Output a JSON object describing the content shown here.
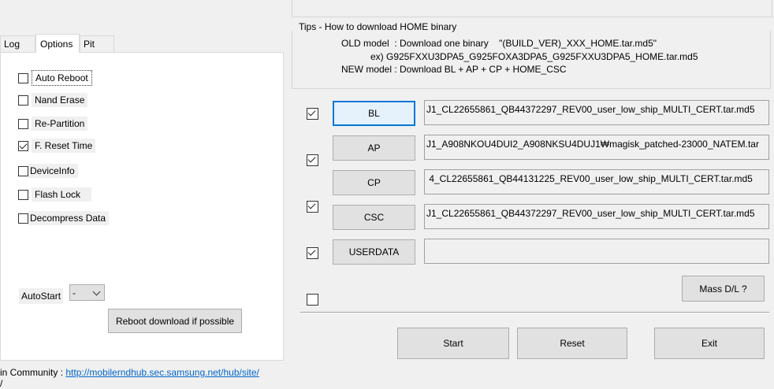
{
  "tabs": [
    {
      "label": "Log"
    },
    {
      "label": "Options"
    },
    {
      "label": "Pit"
    }
  ],
  "options": [
    {
      "label": "Auto Reboot",
      "checked": false
    },
    {
      "label": "Nand Erase",
      "checked": false
    },
    {
      "label": "Re-Partition",
      "checked": false
    },
    {
      "label": "F. Reset Time",
      "checked": true
    },
    {
      "label": "DeviceInfo",
      "checked": false
    },
    {
      "label": "Flash Lock",
      "checked": false
    },
    {
      "label": "Decompress Data",
      "checked": false
    }
  ],
  "autostart": {
    "label": "AutoStart",
    "value": "-"
  },
  "reboot_button": "Reboot download if possible",
  "community": {
    "label": "in Community : ",
    "url": "http://mobilerndhub.sec.samsung.net/hub/site/",
    "extra": "/"
  },
  "tips": {
    "title": "Tips - How to download HOME binary",
    "line1": "OLD model  : Download one binary    \"(BUILD_VER)_XXX_HOME.tar.md5\"",
    "line2": "ex) G925FXXU3DPA5_G925FOXA3DPA5_G925FXXU3DPA5_HOME.tar.md5",
    "line3": "NEW model : Download BL + AP + CP + HOME_CSC"
  },
  "files": [
    {
      "button": "BL",
      "checked": true,
      "path": "J1_CL22655861_QB44372297_REV00_user_low_ship_MULTI_CERT.tar.md5"
    },
    {
      "button": "AP",
      "checked": true,
      "path": "J1_A908NKOU4DUI2_A908NKSU4DUJ1₩magisk_patched-23000_NATEM.tar"
    },
    {
      "button": "CP",
      "checked": true,
      "path": " 4_CL22655861_QB44131225_REV00_user_low_ship_MULTI_CERT.tar.md5"
    },
    {
      "button": "CSC",
      "checked": true,
      "path": "J1_CL22655861_QB44372297_REV00_user_low_ship_MULTI_CERT.tar.md5"
    },
    {
      "button": "USERDATA",
      "checked": false,
      "path": ""
    }
  ],
  "mass_dl": "Mass D/L ?",
  "actions": {
    "start": "Start",
    "reset": "Reset",
    "exit": "Exit"
  }
}
